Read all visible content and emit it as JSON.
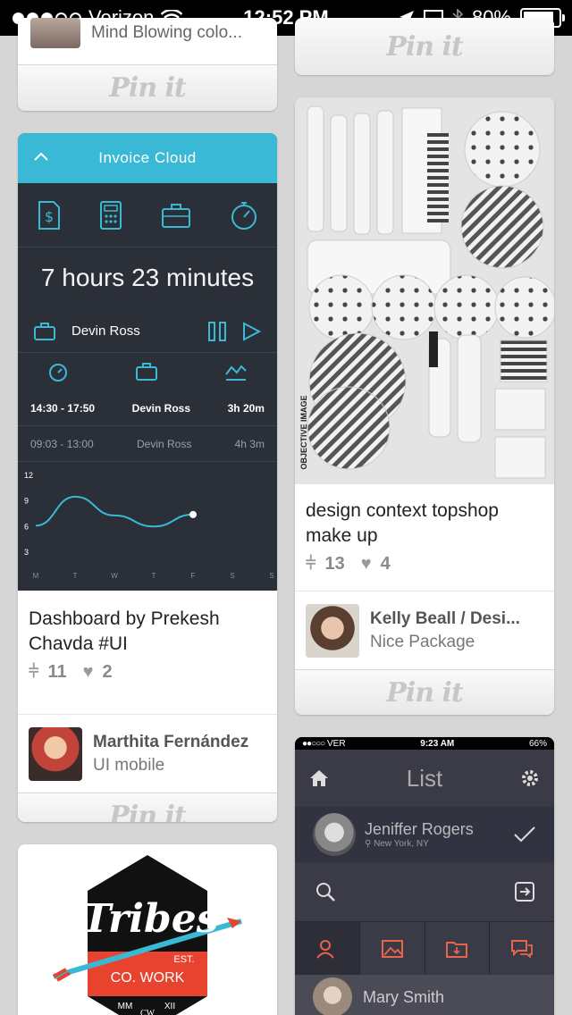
{
  "status": {
    "carrier": "Verizon",
    "time": "12:52 PM",
    "battery": "80%"
  },
  "top_left": {
    "caption": "Mind Blowing colo...",
    "pin_label": "Pin it"
  },
  "top_right": {
    "pin_label": "Pin it"
  },
  "dashboard_pin": {
    "app_title": "Invoice Cloud",
    "hours_num": "7",
    "hours_word": "hours",
    "minutes_num": "23",
    "minutes_word": "minutes",
    "active_user": "Devin Ross",
    "rows": [
      {
        "time": "14:30 - 17:50",
        "name": "Devin Ross",
        "duration": "3h 20m"
      },
      {
        "time": "09:03 - 13:00",
        "name": "Devin Ross",
        "duration": "4h 3m"
      }
    ],
    "chart_data": {
      "type": "line",
      "categories": [
        "M",
        "T",
        "W",
        "T",
        "F",
        "S",
        "S"
      ],
      "values": [
        6,
        9.4,
        7.2,
        5.9,
        7.3
      ],
      "yticks": [
        "12",
        "9",
        "6",
        "3"
      ],
      "ylim": [
        3,
        12
      ]
    },
    "description": "Dashboard by Prekesh Chavda #UI",
    "repins": "11",
    "likes": "2",
    "pinner_name": "Marthita Fernández",
    "board": "UI mobile",
    "pin_label": "Pin it"
  },
  "makeup_pin": {
    "image_caption": "OBJECTIVE IMAGE",
    "description": "design context topshop make up",
    "repins": "13",
    "likes": "4",
    "pinner_name": "Kelly Beall / Desi...",
    "board": "Nice Package",
    "pin_label": "Pin it"
  },
  "tribes_pin": {
    "logo_text": "Tribes",
    "sub1": "EST.",
    "sub2": "CO. WORK",
    "sub3": "MM",
    "sub4": "XII",
    "sub5": "CW"
  },
  "list_pin": {
    "status_carrier": "VER",
    "status_time": "9:23 AM",
    "status_battery": "66%",
    "title": "List",
    "person1": "Jeniffer Rogers",
    "person1_location": "New York, NY",
    "person2": "Mary Smith"
  },
  "colors": {
    "accent": "#3ab9d6",
    "dash_bg": "#2b2f38",
    "pin_text": "#c7c7c7"
  }
}
